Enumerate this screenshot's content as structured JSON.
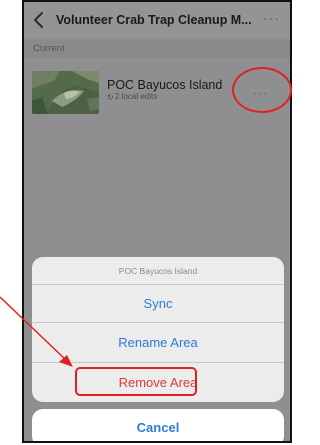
{
  "navbar": {
    "title": "Volunteer Crab Trap Cleanup M...",
    "more": "···"
  },
  "section": {
    "label": "Current"
  },
  "area": {
    "name": "POC Bayucos Island",
    "edits": "2 local edits",
    "sync_glyph": "↻",
    "more": "···"
  },
  "action_sheet": {
    "title": "POC Bayucos Island",
    "sync_label": "Sync",
    "rename_label": "Rename Area",
    "remove_label": "Remove Area",
    "cancel_label": "Cancel"
  },
  "icons": {
    "back": "chevron-left-icon",
    "more": "ellipsis-icon",
    "sync": "sync-icon"
  },
  "colors": {
    "link_blue": "#2f7bd6",
    "destructive_red": "#d93b3b",
    "annotation_red": "#e12121"
  }
}
